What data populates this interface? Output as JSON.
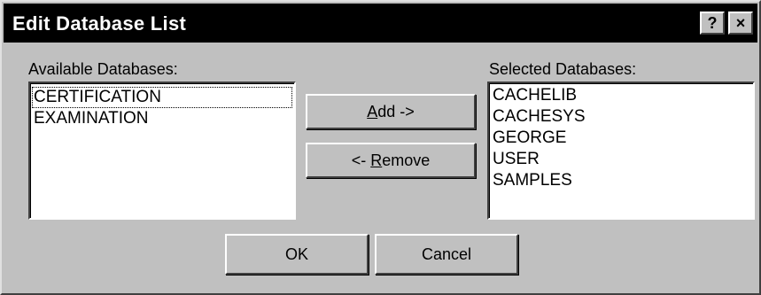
{
  "window": {
    "title": "Edit Database List",
    "help_label": "?",
    "close_label": "×"
  },
  "available": {
    "label": "Available Databases:",
    "items": [
      "CERTIFICATION",
      "EXAMINATION"
    ]
  },
  "selected": {
    "label": "Selected Databases:",
    "items": [
      "CACHELIB",
      "CACHESYS",
      "GEORGE",
      "USER",
      "SAMPLES"
    ]
  },
  "buttons": {
    "add_mnemonic": "A",
    "add_rest": "dd ->",
    "remove_prefix": "<- ",
    "remove_mnemonic": "R",
    "remove_rest": "emove",
    "ok": "OK",
    "cancel": "Cancel"
  },
  "colors": {
    "titlebar": "#000000",
    "face": "#c0c0c0",
    "list_bg": "#ffffff"
  }
}
